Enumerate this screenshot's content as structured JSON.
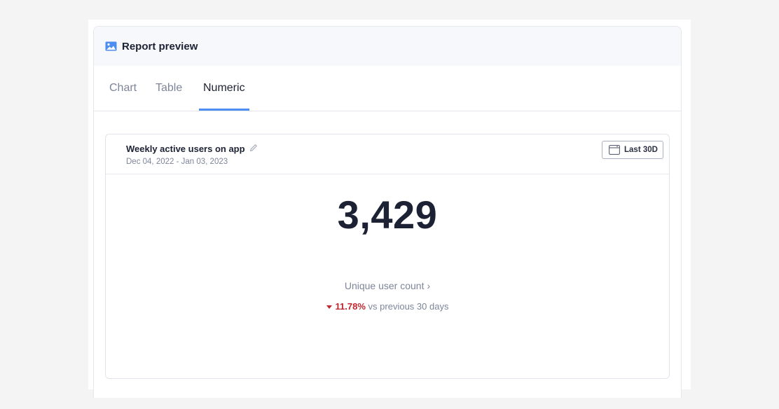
{
  "panel": {
    "title": "Report preview",
    "header_icon": "image-icon"
  },
  "tabs": [
    {
      "label": "Chart",
      "active": false
    },
    {
      "label": "Table",
      "active": false
    },
    {
      "label": "Numeric",
      "active": true
    }
  ],
  "card": {
    "title": "Weekly active users on app",
    "date_range": "Dec 04, 2022 - Jan 03, 2023",
    "range_button": "Last 30D",
    "metric": {
      "value": "3,429",
      "label": "Unique user count",
      "change_pct": "11.78%",
      "change_direction": "down",
      "change_suffix": "vs previous 30 days"
    }
  },
  "colors": {
    "accent": "#4b8df0",
    "negative": "#c0262d",
    "muted": "#7d8599",
    "text": "#1c2233"
  }
}
